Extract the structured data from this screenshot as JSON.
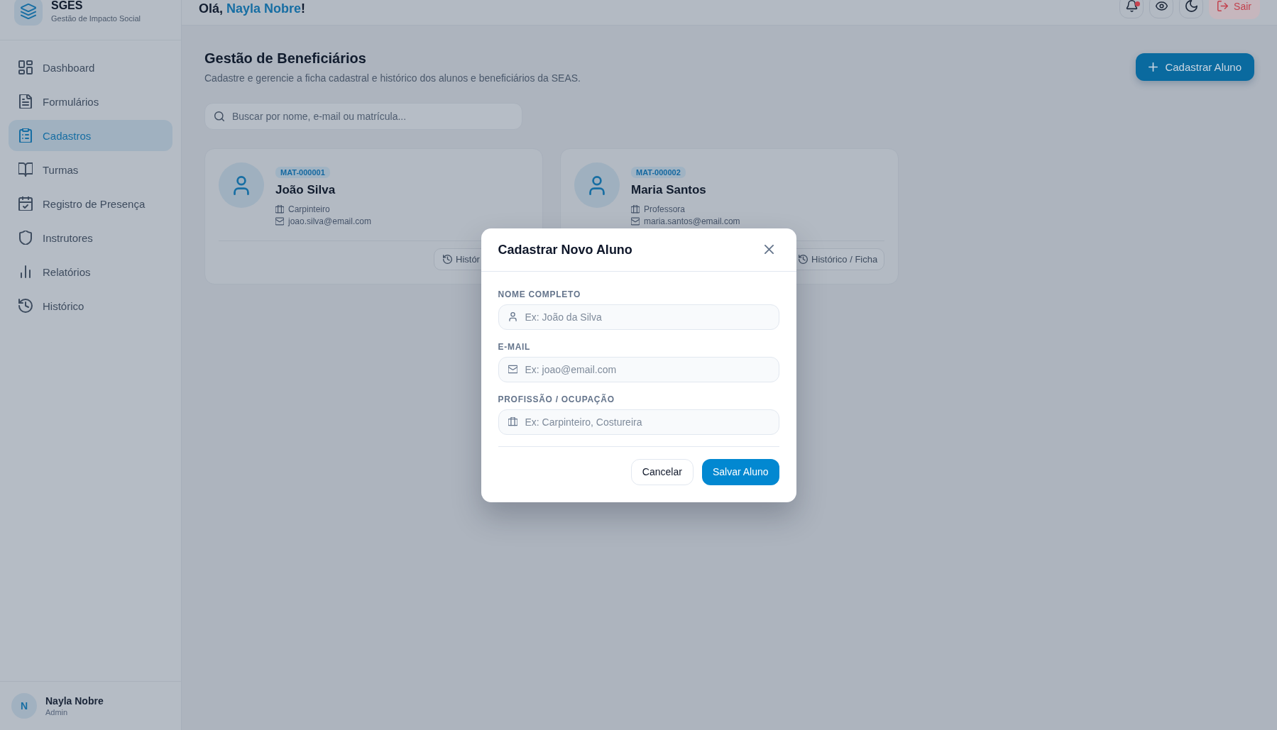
{
  "sidebar": {
    "brand": {
      "name": "SGES",
      "tagline": "Gestão de Impacto Social"
    },
    "items": [
      {
        "label": "Dashboard",
        "kind": "dashboard",
        "selected": false
      },
      {
        "label": "Formulários",
        "kind": "forms",
        "selected": false
      },
      {
        "label": "Cadastros",
        "kind": "records",
        "selected": true
      },
      {
        "label": "Turmas",
        "kind": "classes",
        "selected": false
      },
      {
        "label": "Registro de Presença",
        "kind": "attendance",
        "selected": false
      },
      {
        "label": "Instrutores",
        "kind": "instructors",
        "selected": false
      },
      {
        "label": "Relatórios",
        "kind": "reports",
        "selected": false
      },
      {
        "label": "Histórico",
        "kind": "history",
        "selected": false
      }
    ],
    "user": {
      "initial": "N",
      "name": "Nayla Nobre",
      "role": "Admin"
    }
  },
  "topbar": {
    "greeting": {
      "prefix": "Olá,",
      "name": "Nayla Nobre",
      "suffix": "!"
    },
    "notifications_unread": true,
    "logout": "Sair"
  },
  "page": {
    "title": "Gestão de Beneficiários",
    "subtitle": "Cadastre e gerencie a ficha cadastral e histórico dos alunos e beneficiários da SEAS.",
    "primary_action": "Cadastrar Aluno",
    "search": {
      "placeholder": "Buscar por nome, e-mail ou matrícula..."
    }
  },
  "students": [
    {
      "registration": "MAT-000001",
      "name": "João Silva",
      "occupation": "Carpinteiro",
      "email": "joao.silva@email.com",
      "history_button": "Histór"
    },
    {
      "registration": "MAT-000002",
      "name": "Maria Santos",
      "occupation": "Professora",
      "email": "maria.santos@email.com",
      "history_button": "Histórico / Ficha"
    }
  ],
  "modal": {
    "title": "Cadastrar Novo Aluno",
    "fields": [
      {
        "label": "NOME COMPLETO",
        "kind": "person",
        "placeholder": "Ex: João da Silva"
      },
      {
        "label": "E-MAIL",
        "kind": "email",
        "placeholder": "Ex: joao@email.com"
      },
      {
        "label": "PROFISSÃO / OCUPAÇÃO",
        "kind": "occupation",
        "placeholder": "Ex: Carpinteiro, Costureira"
      }
    ],
    "cancel": "Cancelar",
    "save": "Salvar Aluno"
  }
}
